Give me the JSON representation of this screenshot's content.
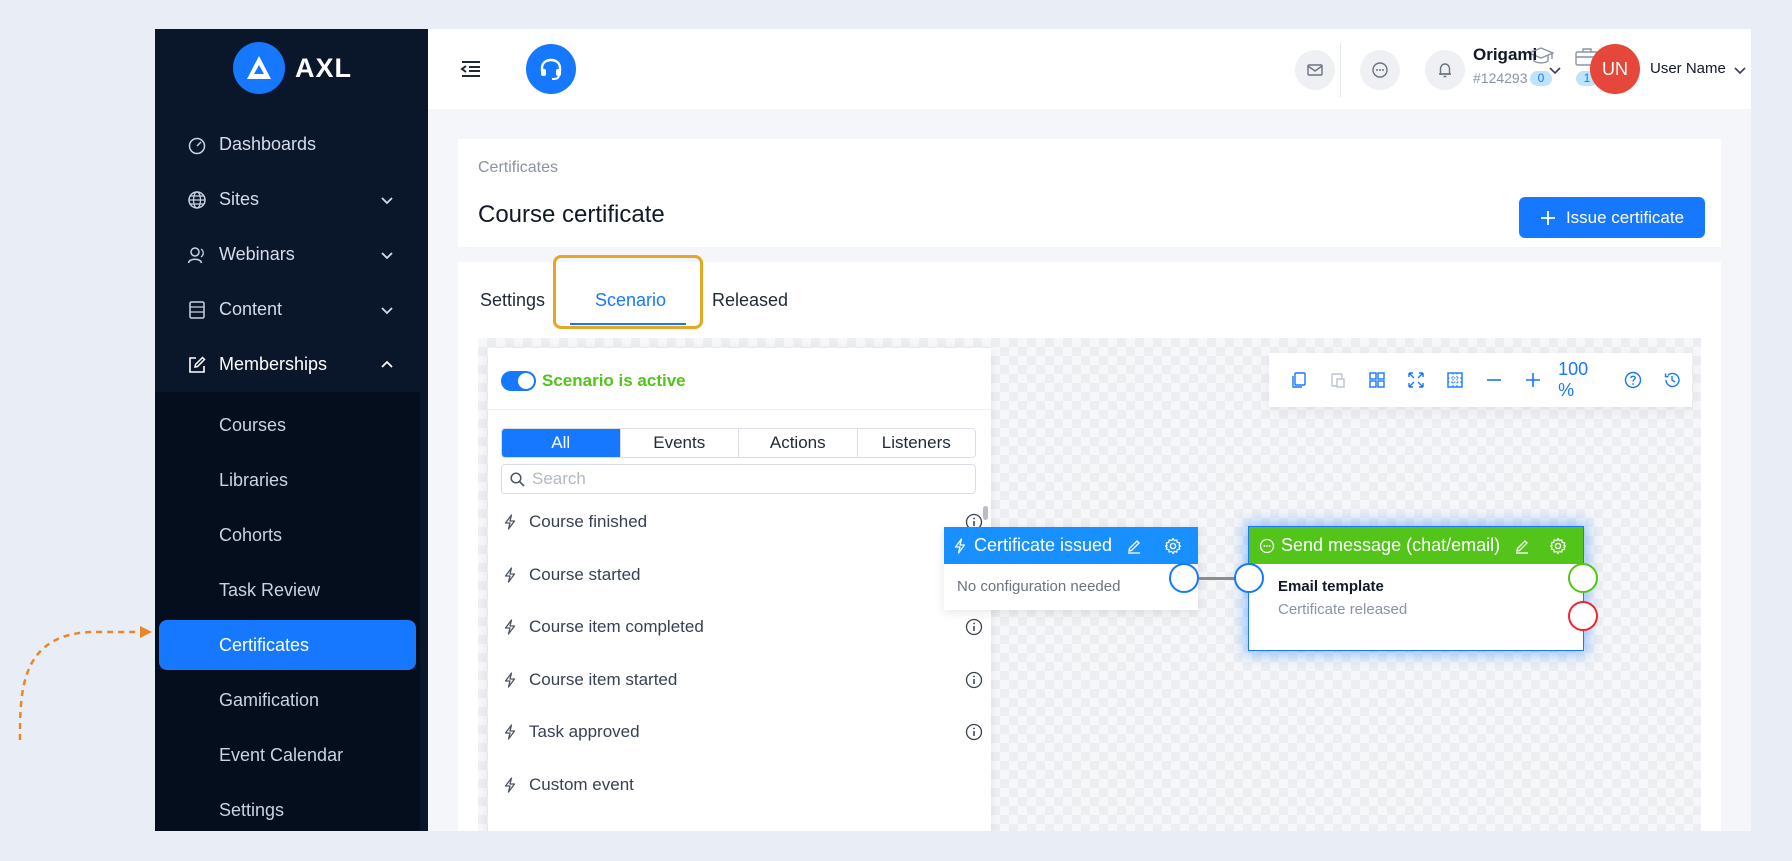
{
  "brand": {
    "name": "AXL"
  },
  "sidebar": {
    "items": [
      {
        "label": "Dashboards",
        "icon": "dashboard-icon",
        "has_children": false
      },
      {
        "label": "Sites",
        "icon": "globe-icon",
        "has_children": true
      },
      {
        "label": "Webinars",
        "icon": "webinar-icon",
        "has_children": true
      },
      {
        "label": "Content",
        "icon": "content-icon",
        "has_children": true
      },
      {
        "label": "Memberships",
        "icon": "edit-square-icon",
        "has_children": true,
        "open": true
      }
    ],
    "submenu": [
      {
        "label": "Courses"
      },
      {
        "label": "Libraries"
      },
      {
        "label": "Cohorts"
      },
      {
        "label": "Task Review"
      },
      {
        "label": "Certificates",
        "active": true
      },
      {
        "label": "Gamification"
      },
      {
        "label": "Event Calendar"
      },
      {
        "label": "Settings"
      }
    ]
  },
  "header": {
    "stats": [
      {
        "icon": "graduation-cap-icon",
        "count": "0"
      },
      {
        "icon": "briefcase-icon",
        "count": "1"
      }
    ],
    "org": {
      "name": "Origami",
      "id": "#124293"
    },
    "user": {
      "initials": "UN",
      "name": "User Name"
    }
  },
  "page": {
    "breadcrumb": "Certificates",
    "title": "Course certificate",
    "issue_button": "Issue certificate"
  },
  "tabs": [
    {
      "label": "Settings"
    },
    {
      "label": "Scenario",
      "active": true
    },
    {
      "label": "Released"
    }
  ],
  "palette": {
    "active_label": "Scenario is active",
    "filters": [
      "All",
      "Events",
      "Actions",
      "Listeners"
    ],
    "search_placeholder": "Search",
    "items": [
      {
        "label": "Course finished",
        "info": true
      },
      {
        "label": "Course started",
        "info": false
      },
      {
        "label": "Course item completed",
        "info": true
      },
      {
        "label": "Course item started",
        "info": true
      },
      {
        "label": "Task approved",
        "info": true
      },
      {
        "label": "Custom event",
        "info": false
      }
    ]
  },
  "toolbar": {
    "zoom": "100 %"
  },
  "nodes": {
    "trigger": {
      "title": "Certificate issued",
      "body": "No configuration needed",
      "color": "#1890ff"
    },
    "action": {
      "title": "Send message (chat/email)",
      "field_label": "Email template",
      "field_value": "Certificate released",
      "color": "#52c41a"
    }
  },
  "colors": {
    "accent": "#1677ff",
    "sidebar_bg": "#0a1629",
    "highlight": "#e7a623",
    "annotation": "#e8862a"
  }
}
